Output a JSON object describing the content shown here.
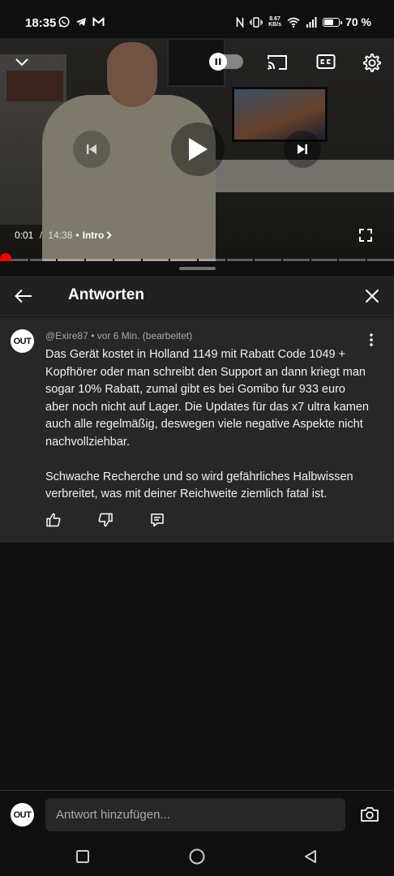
{
  "status_bar": {
    "time": "18:35",
    "net_speed_value": "8.67",
    "net_speed_unit": "KB/s",
    "battery_percent": "70 %",
    "battery_level": 0.7,
    "left_icons": [
      "whatsapp-icon",
      "telegram-icon",
      "gmail-icon"
    ],
    "right_icons": [
      "nfc-icon",
      "vibrate-icon",
      "wifi-icon",
      "cell-signal-icon",
      "battery-icon"
    ]
  },
  "player": {
    "current_time": "0:01",
    "separator": " / ",
    "duration": "14:38",
    "bullet": "•",
    "chapter": "Intro",
    "progress_fraction": 0.001,
    "controls": [
      "collapse-icon",
      "autoplay-toggle",
      "cast-icon",
      "cc-icon",
      "settings-icon",
      "previous-icon",
      "play-icon",
      "next-icon",
      "fullscreen-icon"
    ]
  },
  "panel": {
    "title": "Antworten"
  },
  "comment": {
    "avatar_text": "OUT",
    "author": "@Exire87",
    "bullet": "•",
    "time": "vor 6 Min. (bearbeitet)",
    "paragraph1": "Das Gerät kostet in Holland 1149 mit Rabatt Code 1049 + Kopfhörer oder man schreibt den Support an dann kriegt man sogar 10% Rabatt, zumal gibt es bei Gomibo fur 933 euro aber noch nicht auf Lager. Die Updates für das x7 ultra kamen auch alle regelmäßig, deswegen viele negative Aspekte nicht nachvollziehbar.",
    "paragraph2": "Schwache Recherche und so wird gefährliches Halbwissen verbreitet, was mit deiner Reichweite ziemlich fatal ist.",
    "actions": [
      "like-icon",
      "dislike-icon",
      "reply-icon"
    ]
  },
  "reply": {
    "avatar_text": "OUT",
    "placeholder": "Antwort hinzufügen..."
  },
  "nav": {
    "buttons": [
      "recents-icon",
      "home-icon",
      "back-icon"
    ]
  }
}
